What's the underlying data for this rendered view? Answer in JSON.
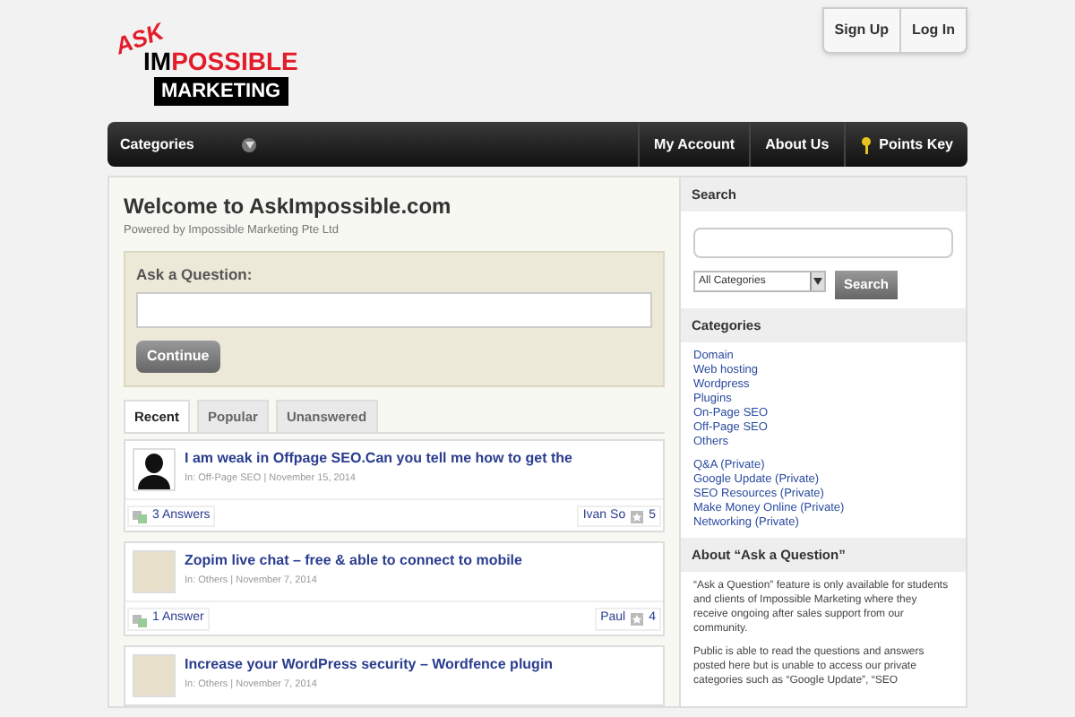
{
  "header": {
    "logo": {
      "ask": "ASK",
      "im": "IM",
      "possible": "POSSIBLE",
      "marketing": "MARKETING"
    },
    "account_links": [
      "Sign Up",
      "Log In"
    ]
  },
  "nav": {
    "categories": "Categories",
    "items": [
      {
        "label": "My Account",
        "kind": "link"
      },
      {
        "label": "About Us",
        "kind": "link"
      },
      {
        "label": "Points Key",
        "kind": "key"
      }
    ]
  },
  "welcome": {
    "title": "Welcome to AskImpossible.com",
    "subtitle": "Powered by Impossible Marketing Pte Ltd"
  },
  "ask": {
    "label": "Ask a Question:",
    "button": "Continue"
  },
  "tabs": [
    {
      "label": "Recent",
      "selected": true
    },
    {
      "label": "Popular",
      "selected": false
    },
    {
      "label": "Unanswered",
      "selected": false
    }
  ],
  "questions": [
    {
      "title": "I am weak in Offpage SEO.Can you tell me how to get the",
      "meta": "In: Off-Page SEO | November 15, 2014",
      "kind": "silhouette",
      "answers": "3 Answers",
      "user": "Ivan So",
      "points": "5"
    },
    {
      "title": "Zopim live chat – free & able to connect to mobile",
      "meta": "In: Others | November 7, 2014",
      "kind": "image",
      "answers": "1 Answer",
      "user": "Paul",
      "points": "4"
    },
    {
      "title": "Increase your WordPress security – Wordfence plugin",
      "meta": "In: Others | November 7, 2014",
      "kind": "image"
    }
  ],
  "sidebar": {
    "search": {
      "heading": "Search",
      "select": "All Categories",
      "button": "Search"
    },
    "categories": {
      "heading": "Categories",
      "groups": [
        [
          "Domain",
          "Web hosting",
          "Wordpress",
          "Plugins",
          "On-Page SEO",
          "Off-Page SEO",
          "Others"
        ],
        [
          "Q&A (Private)",
          "Google Update (Private)",
          "SEO Resources (Private)",
          "Make Money Online (Private)",
          "Networking (Private)"
        ]
      ]
    },
    "about": {
      "heading": "About “Ask a Question”",
      "paragraphs": [
        "“Ask a Question” feature is only available for students and clients of Impossible Marketing where they receive ongoing after sales support from our community.",
        "Public is able to read the questions and answers posted here but is unable to access our private categories such as “Google Update”, “SEO"
      ]
    }
  }
}
